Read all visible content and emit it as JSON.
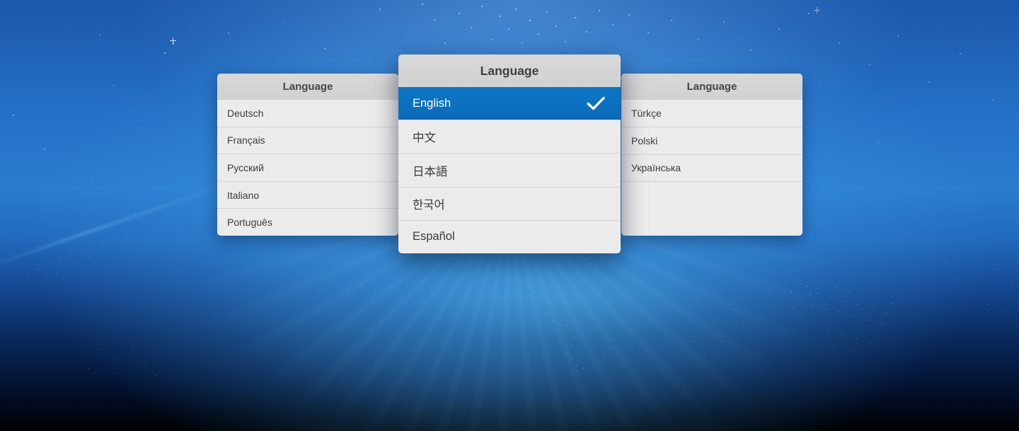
{
  "colors": {
    "accent_blue": "#0b6fc0",
    "panel_header_bg": "#d4d4d4",
    "panel_row_bg": "#ebebeb",
    "row_separator": "#d3d3d3",
    "selected_text": "#ffffff",
    "sky_blue": "#2a7ccf"
  },
  "panels": [
    {
      "header": "Language",
      "items": [
        {
          "label": "Deutsch"
        },
        {
          "label": "Français"
        },
        {
          "label": "Русский"
        },
        {
          "label": "Italiano"
        },
        {
          "label": "Português"
        }
      ]
    },
    {
      "header": "Language",
      "selected_item": "English",
      "items": [
        {
          "label": "English",
          "selected": true
        },
        {
          "label": "中文"
        },
        {
          "label": "日本語"
        },
        {
          "label": "한국어"
        },
        {
          "label": "Español"
        }
      ]
    },
    {
      "header": "Language",
      "items": [
        {
          "label": "Türkçe"
        },
        {
          "label": "Polski"
        },
        {
          "label": "Українська"
        }
      ]
    }
  ],
  "icons": {
    "selected_indicator": "check-icon"
  }
}
